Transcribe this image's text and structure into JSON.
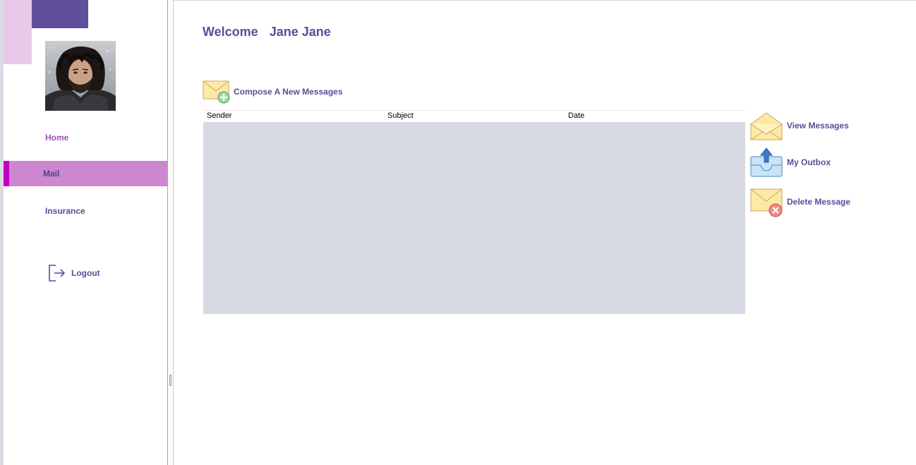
{
  "header": {
    "welcome_label": "Welcome",
    "user_name": "Jane Jane"
  },
  "sidebar": {
    "avatar_alt": "User avatar",
    "items": [
      {
        "label": "Home"
      },
      {
        "label": "Mail"
      },
      {
        "label": "Insurance"
      }
    ],
    "logout_label": "Logout"
  },
  "mail": {
    "compose_label": "Compose A New Messages",
    "columns": [
      "Sender",
      "Subject",
      "Date"
    ],
    "rows": []
  },
  "actions": {
    "view_label": "View Messages",
    "outbox_label": "My Outbox",
    "delete_label": "Delete Message"
  },
  "icons": {
    "compose": "envelope-plus-icon",
    "view": "open-envelope-icon",
    "outbox": "outbox-tray-icon",
    "delete": "envelope-delete-icon",
    "logout": "logout-icon"
  },
  "colors": {
    "accent_purple": "#5a4d96",
    "nav_active_bg": "#cd87cf",
    "nav_active_marker": "#c400c4",
    "home_link": "#a04dbb",
    "grid_body": "#d6d9e2"
  }
}
